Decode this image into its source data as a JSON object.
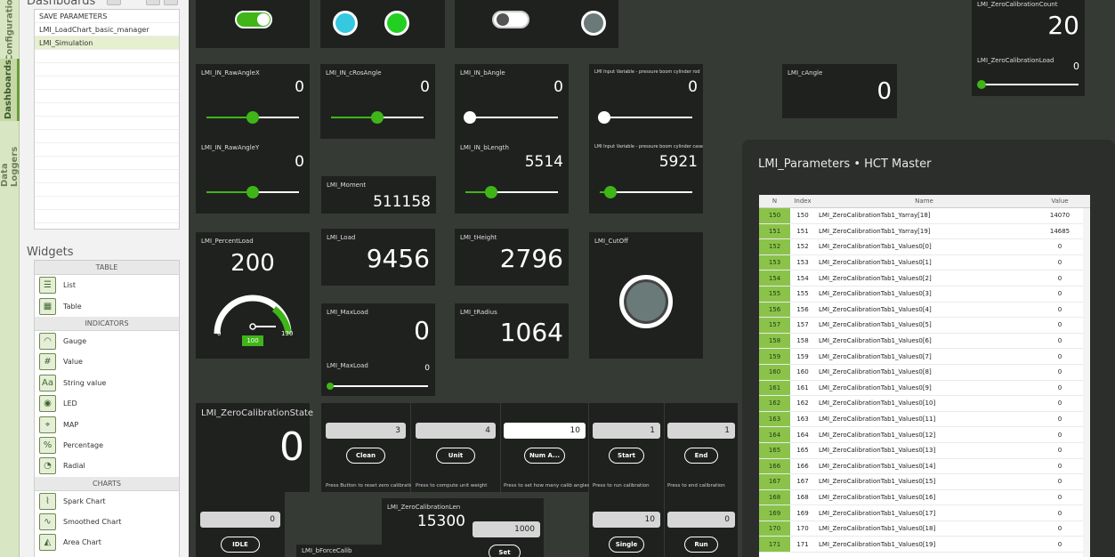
{
  "sidebar": {
    "tabs": [
      "Configuration",
      "Dashboards",
      "Data Loggers"
    ],
    "dashboards_title": "Dashboards",
    "dashboards": [
      "SAVE PARAMETERS",
      "LMI_LoadChart_basic_manager",
      "LMI_Simulation"
    ],
    "widgets_title": "Widgets",
    "categories": [
      {
        "name": "TABLE",
        "items": [
          {
            "label": "List",
            "icon": "list-icon"
          },
          {
            "label": "Table",
            "icon": "table-icon"
          }
        ]
      },
      {
        "name": "INDICATORS",
        "items": [
          {
            "label": "Gauge",
            "icon": "gauge-icon"
          },
          {
            "label": "Value",
            "icon": "value-icon"
          },
          {
            "label": "String value",
            "icon": "string-value-icon"
          },
          {
            "label": "LED",
            "icon": "led-icon"
          },
          {
            "label": "MAP",
            "icon": "map-icon"
          },
          {
            "label": "Percentage",
            "icon": "percentage-icon"
          },
          {
            "label": "Radial",
            "icon": "radial-icon"
          }
        ]
      },
      {
        "name": "CHARTS",
        "items": [
          {
            "label": "Spark Chart",
            "icon": "spark-chart-icon"
          },
          {
            "label": "Smoothed Chart",
            "icon": "smoothed-chart-icon"
          },
          {
            "label": "Area Chart",
            "icon": "area-chart-icon"
          }
        ]
      }
    ]
  },
  "widgets": {
    "zero_count": {
      "label": "LMI_ZeroCalibrationCount",
      "value": "20"
    },
    "zero_load": {
      "label": "LMI_ZeroCalibrationLoad",
      "value": "0"
    },
    "raw_x": {
      "label": "LMI_IN_RawAngleX",
      "value": "0"
    },
    "cros_angle": {
      "label": "LMI_IN_cRosAngle",
      "value": "0"
    },
    "b_angle": {
      "label": "LMI_IN_bAngle",
      "value": "0"
    },
    "pressure_rod": {
      "label": "LMI Input Variable - pressure boom cylinder rod",
      "value": "0"
    },
    "c_angle": {
      "label": "LMI_cAngle",
      "value": "0"
    },
    "raw_y": {
      "label": "LMI_IN_RawAngleY",
      "value": "0"
    },
    "b_length": {
      "label": "LMI_IN_bLength",
      "value": "5514"
    },
    "pressure_case": {
      "label": "LMI Input Variable - pressure boom cylinder case",
      "value": "5921"
    },
    "moment": {
      "label": "LMI_Moment",
      "value": "511158"
    },
    "percent_load": {
      "label": "LMI_PercentLoad",
      "value": "200",
      "gauge_min": "0",
      "gauge_max": "130",
      "gauge_badge": "100"
    },
    "load": {
      "label": "LMI_Load",
      "value": "9456"
    },
    "height": {
      "label": "LMI_tHeight",
      "value": "2796"
    },
    "cutoff": {
      "label": "LMI_CutOff"
    },
    "max_load": {
      "label": "LMI_MaxLoad",
      "value": "0"
    },
    "radius": {
      "label": "LMI_tRadius",
      "value": "1064"
    },
    "max_load_slider": {
      "label": "LMI_MaxLoad",
      "value": "0"
    },
    "zero_state": {
      "label": "LMI_ZeroCalibrationState",
      "value": "0"
    },
    "clean": {
      "input": "3",
      "button": "Clean",
      "hint": "Press Button to reset zero calibration"
    },
    "unit": {
      "input": "4",
      "button": "Unit",
      "hint": "Press to compute unit weight"
    },
    "num": {
      "input": "10",
      "button": "Num A...",
      "hint": "Press to set how many calib angles"
    },
    "start": {
      "input": "1",
      "button": "Start",
      "hint": "Press to run calibration"
    },
    "end": {
      "input": "1",
      "button": "End",
      "hint": "Press to end calibration"
    },
    "idle": {
      "input": "0",
      "button": "IDLE"
    },
    "calib_len": {
      "label": "LMI_ZeroCalibrationLen",
      "value": "15300",
      "input": "1000",
      "button": "Set"
    },
    "force_calib": {
      "label": "LMI_bForceCalib"
    },
    "single": {
      "input": "10",
      "button": "Single"
    },
    "run": {
      "input": "0",
      "button": "Run"
    }
  },
  "params_panel": {
    "title": "LMI_Parameters • HCT Master",
    "columns": [
      "N",
      "Index",
      "Name",
      "Value"
    ],
    "rows": [
      [
        "150",
        "150",
        "LMI_ZeroCalibrationTab1_Yarray[18]",
        "14070"
      ],
      [
        "151",
        "151",
        "LMI_ZeroCalibrationTab1_Yarray[19]",
        "14685"
      ],
      [
        "152",
        "152",
        "LMI_ZeroCalibrationTab1_Values0[0]",
        "0"
      ],
      [
        "153",
        "153",
        "LMI_ZeroCalibrationTab1_Values0[1]",
        "0"
      ],
      [
        "154",
        "154",
        "LMI_ZeroCalibrationTab1_Values0[2]",
        "0"
      ],
      [
        "155",
        "155",
        "LMI_ZeroCalibrationTab1_Values0[3]",
        "0"
      ],
      [
        "156",
        "156",
        "LMI_ZeroCalibrationTab1_Values0[4]",
        "0"
      ],
      [
        "157",
        "157",
        "LMI_ZeroCalibrationTab1_Values0[5]",
        "0"
      ],
      [
        "158",
        "158",
        "LMI_ZeroCalibrationTab1_Values0[6]",
        "0"
      ],
      [
        "159",
        "159",
        "LMI_ZeroCalibrationTab1_Values0[7]",
        "0"
      ],
      [
        "160",
        "160",
        "LMI_ZeroCalibrationTab1_Values0[8]",
        "0"
      ],
      [
        "161",
        "161",
        "LMI_ZeroCalibrationTab1_Values0[9]",
        "0"
      ],
      [
        "162",
        "162",
        "LMI_ZeroCalibrationTab1_Values0[10]",
        "0"
      ],
      [
        "163",
        "163",
        "LMI_ZeroCalibrationTab1_Values0[11]",
        "0"
      ],
      [
        "164",
        "164",
        "LMI_ZeroCalibrationTab1_Values0[12]",
        "0"
      ],
      [
        "165",
        "165",
        "LMI_ZeroCalibrationTab1_Values0[13]",
        "0"
      ],
      [
        "166",
        "166",
        "LMI_ZeroCalibrationTab1_Values0[14]",
        "0"
      ],
      [
        "167",
        "167",
        "LMI_ZeroCalibrationTab1_Values0[15]",
        "0"
      ],
      [
        "168",
        "168",
        "LMI_ZeroCalibrationTab1_Values0[16]",
        "0"
      ],
      [
        "169",
        "169",
        "LMI_ZeroCalibrationTab1_Values0[17]",
        "0"
      ],
      [
        "170",
        "170",
        "LMI_ZeroCalibrationTab1_Values0[18]",
        "0"
      ],
      [
        "171",
        "171",
        "LMI_ZeroCalibrationTab1_Values0[19]",
        "0"
      ]
    ]
  },
  "colors": {
    "accent": "#3fb518",
    "led_cyan": "#36c8e0",
    "led_green": "#22d022",
    "led_off": "#6a7a78"
  }
}
